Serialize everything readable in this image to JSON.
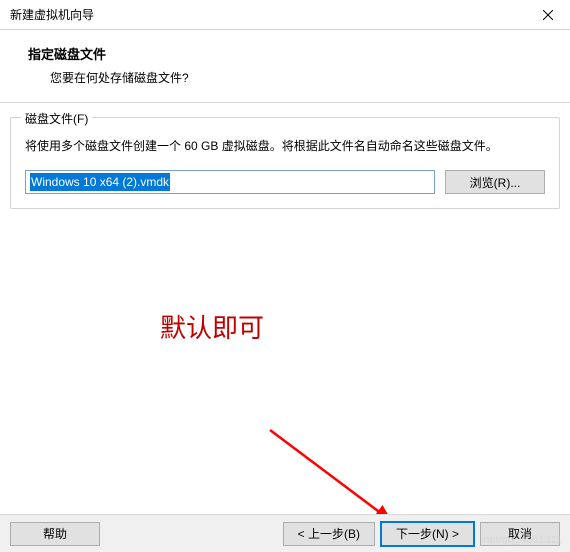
{
  "titlebar": {
    "title": "新建虚拟机向导"
  },
  "header": {
    "title": "指定磁盘文件",
    "description": "您要在何处存储磁盘文件?"
  },
  "fieldset": {
    "label": "磁盘文件(F)",
    "description": "将使用多个磁盘文件创建一个 60 GB 虚拟磁盘。将根据此文件名自动命名这些磁盘文件。",
    "input_value": "Windows 10 x64 (2).vmdk",
    "browse_label": "浏览(R)..."
  },
  "annotation": {
    "text": "默认即可"
  },
  "footer": {
    "help_label": "帮助",
    "back_label": "< 上一步(B)",
    "next_label": "下一步(N) >",
    "cancel_label": "取消"
  },
  "watermark": {
    "text": "net/qq_4051311"
  }
}
